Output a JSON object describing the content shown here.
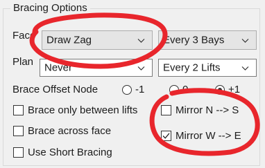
{
  "group": {
    "title": "Bracing Options"
  },
  "face": {
    "label": "Face",
    "pattern": "Draw Zag",
    "interval": "Every 3 Bays"
  },
  "plan": {
    "label": "Plan",
    "pattern": "Never",
    "interval": "Every 2 Lifts"
  },
  "offset": {
    "label": "Brace Offset Node",
    "options": [
      "-1",
      "0",
      "+1"
    ],
    "selected": "+1"
  },
  "checkboxes": {
    "between_lifts": {
      "label": "Brace only between lifts",
      "checked": false
    },
    "across_face": {
      "label": "Brace across face",
      "checked": false
    },
    "short_bracing": {
      "label": "Use Short Bracing",
      "checked": false
    },
    "mirror_ns": {
      "label": "Mirror N --> S",
      "checked": false
    },
    "mirror_we": {
      "label": "Mirror W --> E",
      "checked": true
    }
  },
  "icons": {
    "dropdown": "chevron-down-icon",
    "check": "checkmark-icon"
  },
  "colors": {
    "annotation": "#e8262c"
  }
}
